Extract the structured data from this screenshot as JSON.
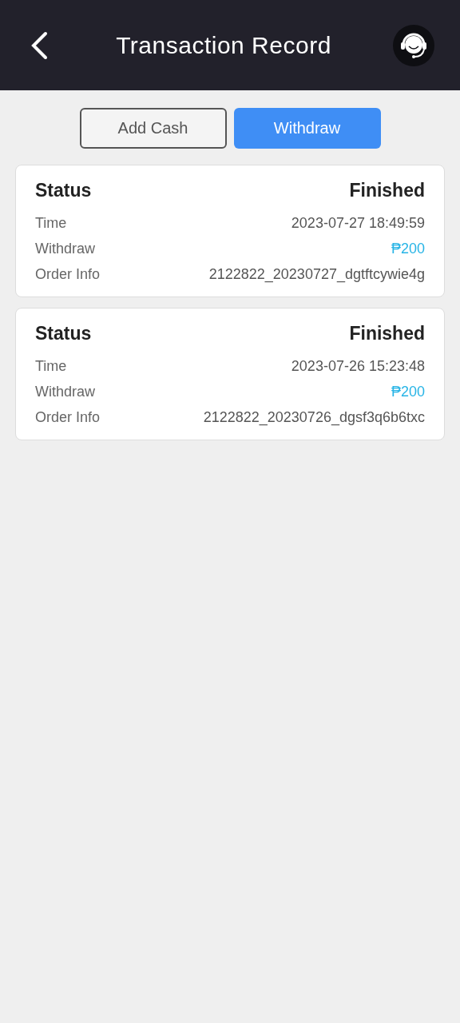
{
  "header": {
    "title": "Transaction Record"
  },
  "tabs": [
    {
      "label": "Add Cash",
      "selected": false
    },
    {
      "label": "Withdraw",
      "selected": true
    }
  ],
  "records": [
    {
      "status_label": "Status",
      "status": "Finished",
      "rows": [
        {
          "label": "Time",
          "value": "2023-07-27 18:49:59",
          "kind": "text"
        },
        {
          "label": "Withdraw",
          "value": "₱200",
          "kind": "amount"
        },
        {
          "label": "Order Info",
          "value": "2122822_20230727_dgtftcywie4g",
          "kind": "text"
        }
      ]
    },
    {
      "status_label": "Status",
      "status": "Finished",
      "rows": [
        {
          "label": "Time",
          "value": "2023-07-26 15:23:48",
          "kind": "text"
        },
        {
          "label": "Withdraw",
          "value": "₱200",
          "kind": "amount"
        },
        {
          "label": "Order Info",
          "value": "2122822_20230726_dgsf3q6b6txc",
          "kind": "text"
        }
      ]
    }
  ]
}
